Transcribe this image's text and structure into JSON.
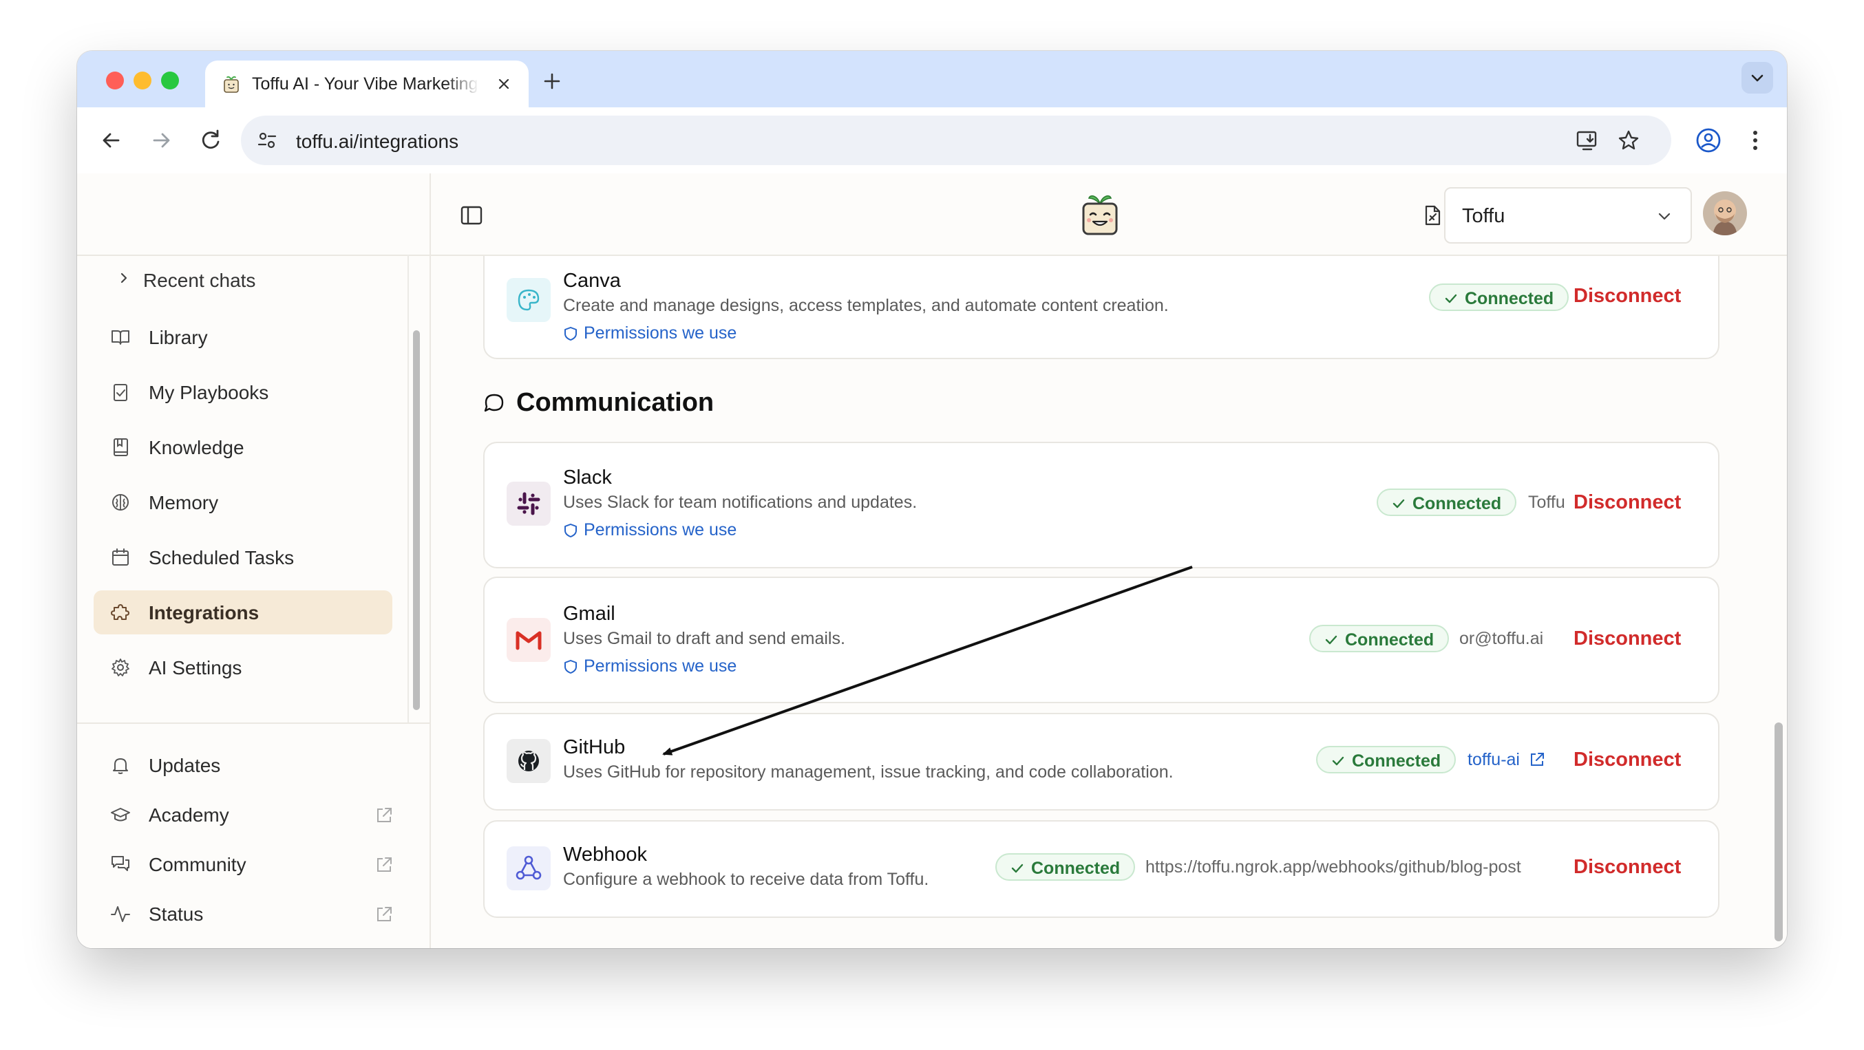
{
  "browser": {
    "tab_title": "Toffu AI - Your Vibe Marketing Agent",
    "url": "toffu.ai/integrations"
  },
  "sidebar": {
    "recent_chats": "Recent chats",
    "items": [
      {
        "label": "Library",
        "icon": "book-icon"
      },
      {
        "label": "My Playbooks",
        "icon": "clipboard-icon"
      },
      {
        "label": "Knowledge",
        "icon": "notebook-icon"
      },
      {
        "label": "Memory",
        "icon": "brain-icon"
      },
      {
        "label": "Scheduled Tasks",
        "icon": "calendar-icon"
      },
      {
        "label": "Integrations",
        "icon": "puzzle-icon",
        "active": true
      },
      {
        "label": "AI Settings",
        "icon": "gear-icon"
      }
    ],
    "bottom_items": [
      {
        "label": "Updates",
        "icon": "bell-icon"
      },
      {
        "label": "Academy",
        "icon": "graduation-cap-icon",
        "external": true
      },
      {
        "label": "Community",
        "icon": "chat-bubbles-icon",
        "external": true
      },
      {
        "label": "Status",
        "icon": "activity-icon",
        "external": true
      }
    ]
  },
  "header": {
    "workspace": "Toffu"
  },
  "integrations": {
    "section_communication": "Communication",
    "permissions_label": "Permissions we use",
    "connected_label": "Connected",
    "disconnect_label": "Disconnect",
    "cards": {
      "canva": {
        "title": "Canva",
        "desc": "Create and manage designs, access templates, and automate content creation."
      },
      "slack": {
        "title": "Slack",
        "desc": "Uses Slack for team notifications and updates.",
        "account": "Toffu"
      },
      "gmail": {
        "title": "Gmail",
        "desc": "Uses Gmail to draft and send emails.",
        "account": "or@toffu.ai"
      },
      "github": {
        "title": "GitHub",
        "desc": "Uses GitHub for repository management, issue tracking, and code collaboration.",
        "account": "toffu-ai"
      },
      "webhook": {
        "title": "Webhook",
        "desc": "Configure a webhook to receive data from Toffu.",
        "account": "https://toffu.ngrok.app/webhooks/github/blog-post"
      }
    }
  },
  "colors": {
    "accent_active": "#f6ead7",
    "connected_green": "#2a7a3b",
    "disconnect_red": "#d12b2b",
    "link_blue": "#2563c9"
  }
}
